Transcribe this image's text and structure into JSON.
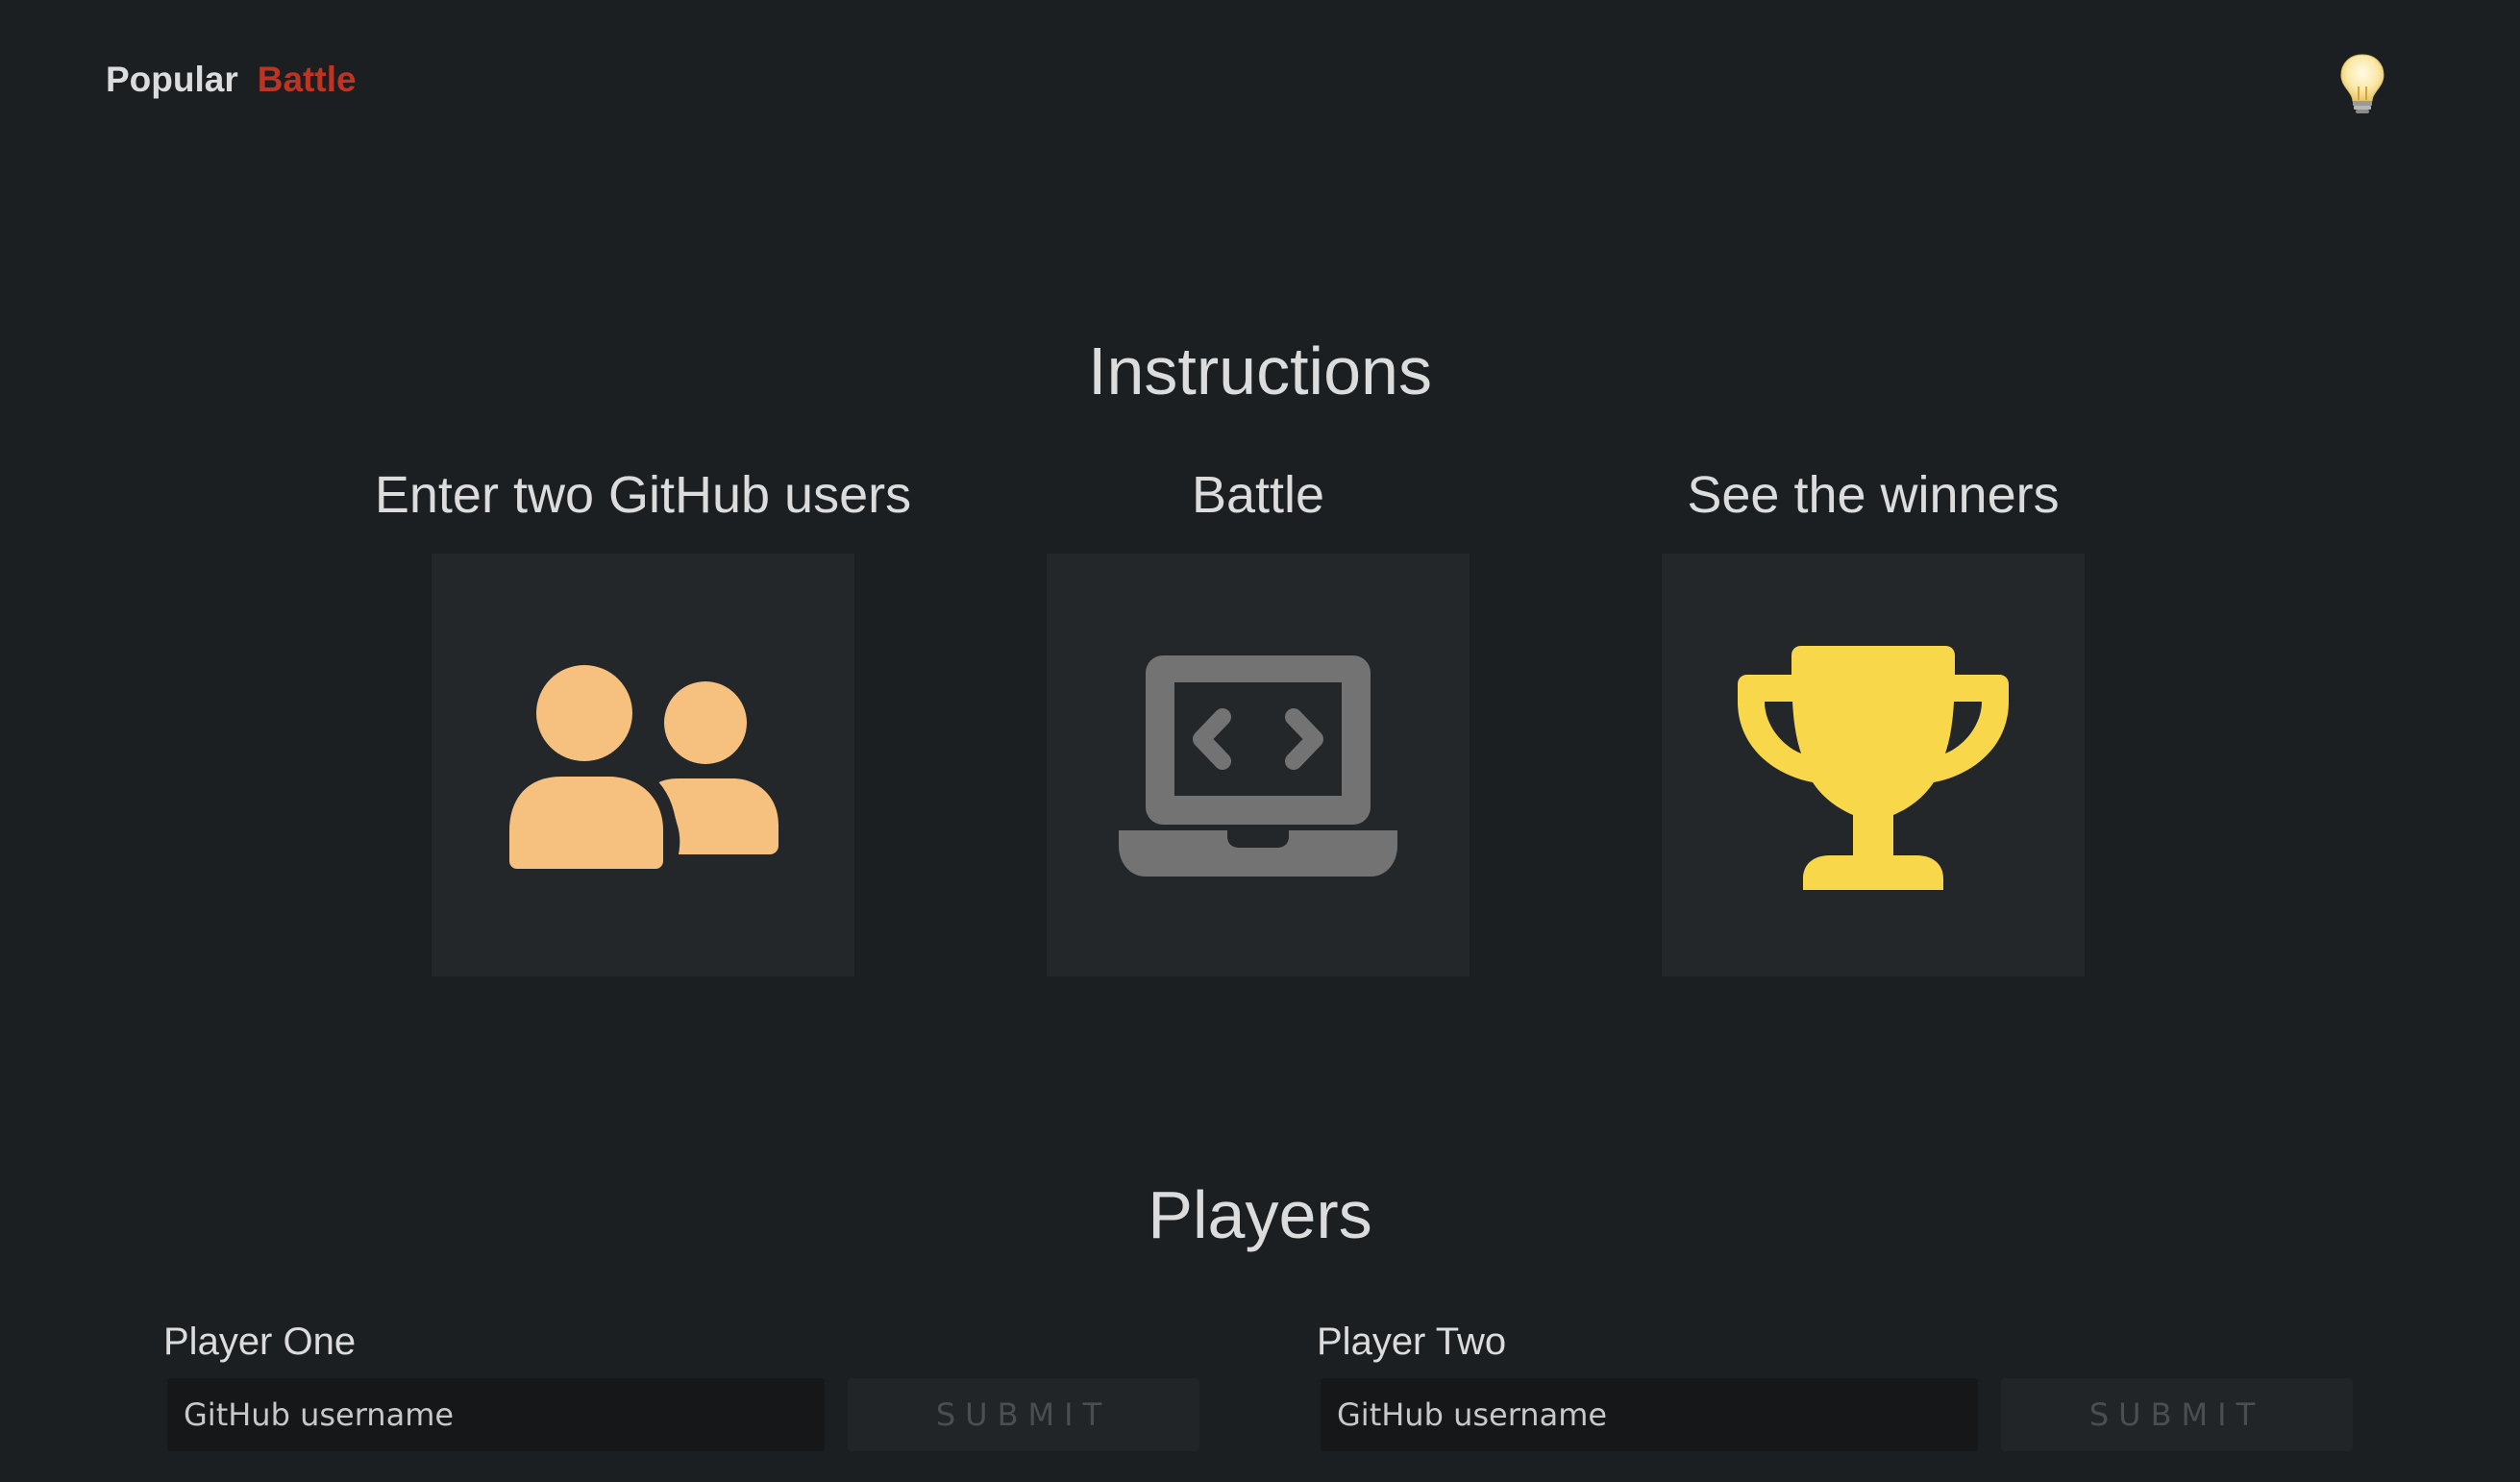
{
  "nav": {
    "popular_label": "Popular",
    "battle_label": "Battle"
  },
  "theme_toggle": {
    "icon": "lightbulb-icon"
  },
  "instructions": {
    "title": "Instructions",
    "steps": [
      {
        "label": "Enter two GitHub users",
        "icon": "users-icon",
        "color": "#f6c07f"
      },
      {
        "label": "Battle",
        "icon": "laptop-code-icon",
        "color": "#737373"
      },
      {
        "label": "See the winners",
        "icon": "trophy-icon",
        "color": "#f8d84a"
      }
    ]
  },
  "players": {
    "title": "Players",
    "player_one": {
      "label": "Player One",
      "placeholder": "GitHub username",
      "submit_label": "SUBMIT"
    },
    "player_two": {
      "label": "Player Two",
      "placeholder": "GitHub username",
      "submit_label": "SUBMIT"
    }
  },
  "colors": {
    "background": "#1c1f22",
    "card": "#24272a",
    "accent": "#bb3424",
    "text": "#dcdcdc"
  }
}
